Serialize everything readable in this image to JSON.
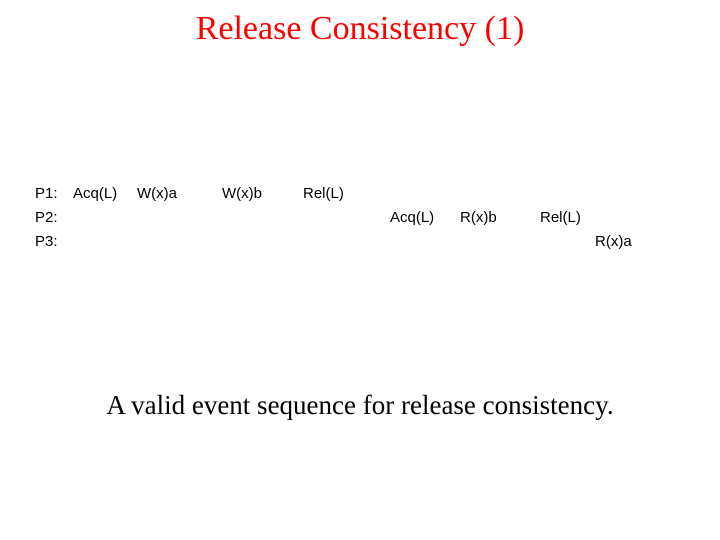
{
  "title": "Release Consistency (1)",
  "processes": {
    "p1": {
      "label": "P1:",
      "acq": "Acq(L)",
      "wxa": "W(x)a",
      "wxb": "W(x)b",
      "rel": "Rel(L)"
    },
    "p2": {
      "label": "P2:",
      "acq": "Acq(L)",
      "rxb": "R(x)b",
      "rel": "Rel(L)"
    },
    "p3": {
      "label": "P3:",
      "rxa": "R(x)a"
    }
  },
  "caption": "A valid event sequence  for release consistency."
}
